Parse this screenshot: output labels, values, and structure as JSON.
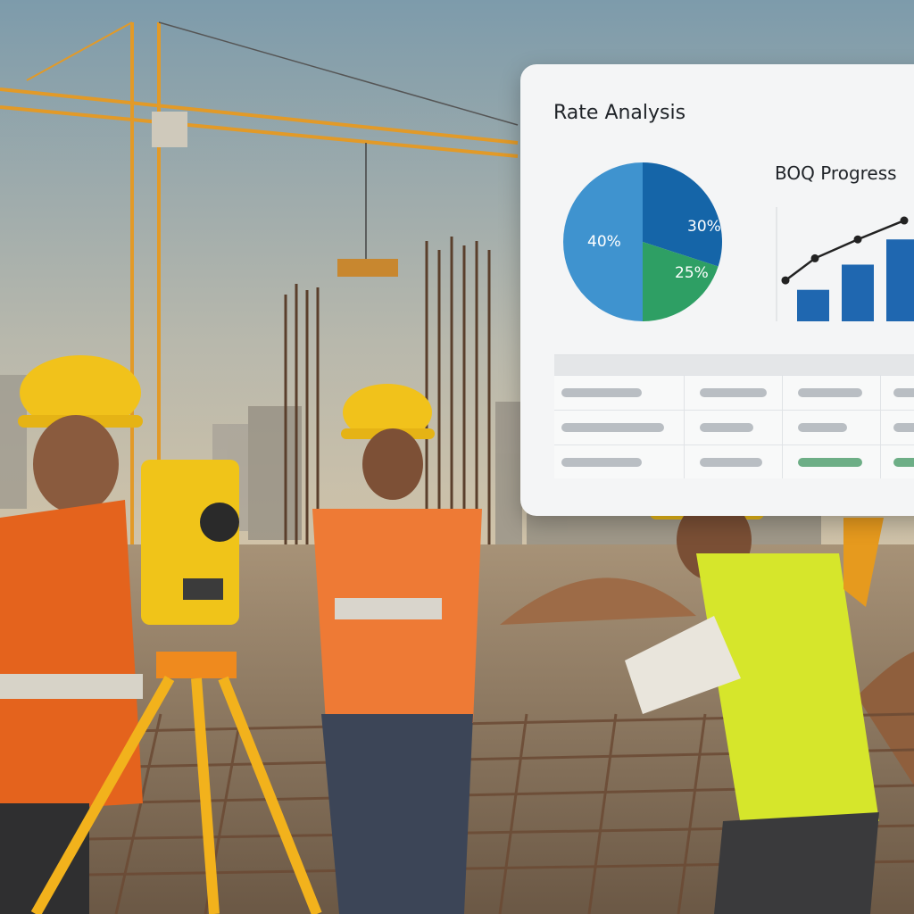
{
  "panel": {
    "title": "Rate Analysis",
    "boq_title": "BOQ Progress"
  },
  "colors": {
    "pie_blue_light": "#3f93cf",
    "pie_blue_dark": "#1565a8",
    "pie_green": "#2e9f64",
    "bar_blue": "#1f67b0",
    "status_green": "#6dae86"
  },
  "chart_data": [
    {
      "type": "pie",
      "title": "Rate Analysis",
      "values": [
        40,
        30,
        25
      ],
      "labels": [
        "40%",
        "30%",
        "25%"
      ]
    },
    {
      "type": "bar",
      "title": "BOQ Progress",
      "values": [
        1,
        1.8,
        2.6
      ],
      "line_overlay": [
        1.3,
        2.0,
        2.6,
        3.2
      ]
    }
  ],
  "table": {
    "rows": 3,
    "status_row": 3
  }
}
